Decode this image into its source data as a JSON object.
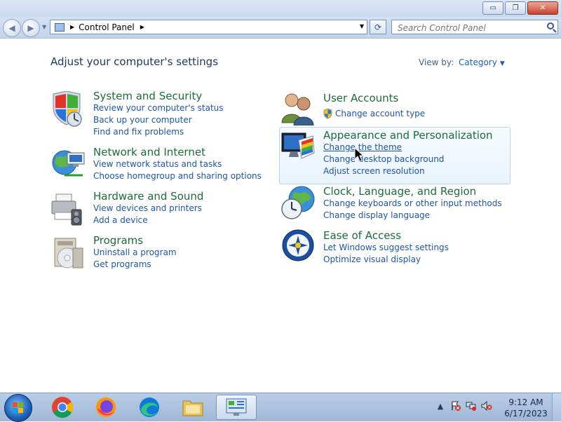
{
  "window": {
    "minimize": "▭",
    "maximize": "❐",
    "close": "✕"
  },
  "address": {
    "crumb": "Control Panel",
    "search_placeholder": "Search Control Panel"
  },
  "content": {
    "heading": "Adjust your computer's settings",
    "view_by_label": "View by:",
    "view_by_value": "Category"
  },
  "categories": [
    {
      "title": "System and Security",
      "icon": "shield-icon",
      "links": [
        "Review your computer's status",
        "Back up your computer",
        "Find and fix problems"
      ]
    },
    {
      "title": "Network and Internet",
      "icon": "globe-network-icon",
      "links": [
        "View network status and tasks",
        "Choose homegroup and sharing options"
      ]
    },
    {
      "title": "Hardware and Sound",
      "icon": "printer-speaker-icon",
      "links": [
        "View devices and printers",
        "Add a device"
      ]
    },
    {
      "title": "Programs",
      "icon": "programs-disc-icon",
      "links": [
        "Uninstall a program",
        "Get programs"
      ]
    },
    {
      "title": "User Accounts",
      "icon": "users-icon",
      "links": [
        "Change account type"
      ]
    },
    {
      "title": "Appearance and Personalization",
      "icon": "monitor-palette-icon",
      "links": [
        "Change the theme",
        "Change desktop background",
        "Adjust screen resolution"
      ]
    },
    {
      "title": "Clock, Language, and Region",
      "icon": "clock-globe-icon",
      "links": [
        "Change keyboards or other input methods",
        "Change display language"
      ]
    },
    {
      "title": "Ease of Access",
      "icon": "ease-of-access-icon",
      "links": [
        "Let Windows suggest settings",
        "Optimize visual display"
      ]
    }
  ],
  "taskbar": {
    "apps": [
      "chrome-icon",
      "firefox-icon",
      "edge-icon",
      "file-explorer-icon",
      "control-panel-icon"
    ],
    "time": "9:12 AM",
    "date": "6/17/2023"
  },
  "colors": {
    "category_title": "#1e6b3a",
    "link": "#1f55a8",
    "heading": "#1e395b"
  }
}
